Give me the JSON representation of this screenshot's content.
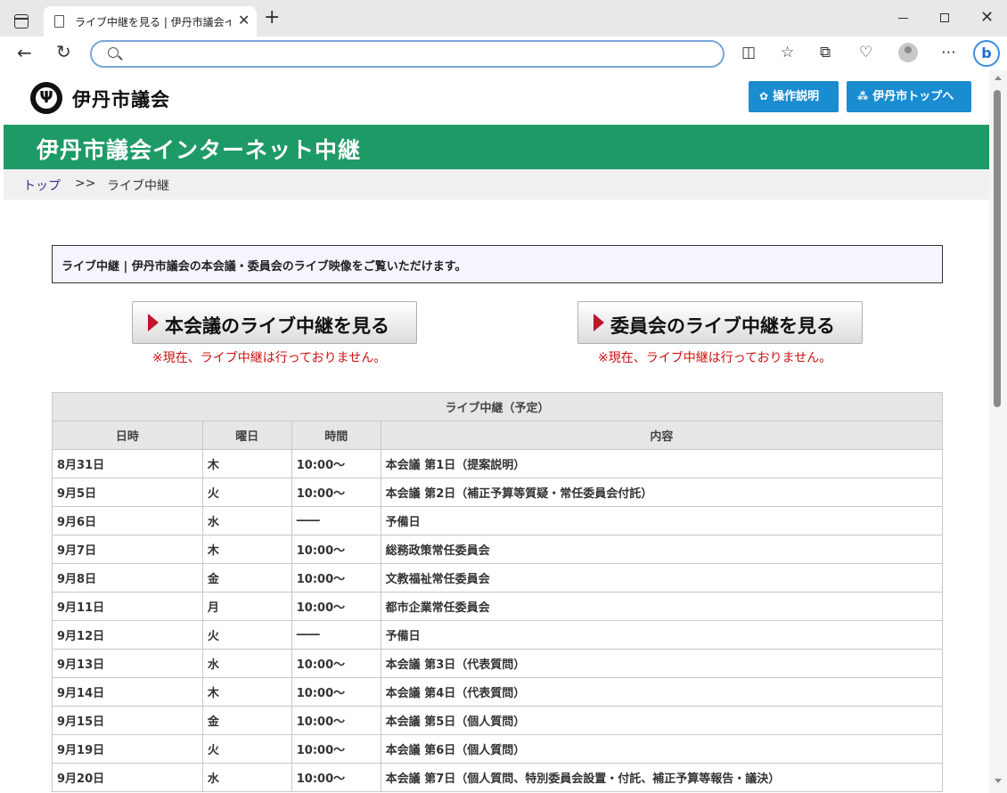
{
  "browser": {
    "tab_title": "ライブ中継を見る | 伊丹市議会インタ",
    "address": ""
  },
  "header": {
    "site_name": "伊丹市議会",
    "help_button": "操作説明",
    "home_button": "伊丹市トップへ",
    "help_icon": "gear-icon",
    "home_icon": "sitemap-icon"
  },
  "banner": {
    "title": "伊丹市議会インターネット中継"
  },
  "breadcrumb": {
    "top": "トップ",
    "separator": ">>",
    "current": "ライブ中継"
  },
  "intro": "ライブ中継 | 伊丹市議会の本会議・委員会のライブ映像をご覧いただけます。",
  "live": {
    "plenary_button": "本会議のライブ中継を見る",
    "committee_button": "委員会のライブ中継を見る",
    "plenary_notice": "※現在、ライブ中継は行っておりません。",
    "committee_notice": "※現在、ライブ中継は行っておりません。"
  },
  "schedule": {
    "caption": "ライブ中継（予定）",
    "headers": [
      "日時",
      "曜日",
      "時間",
      "内容"
    ],
    "rows": [
      [
        "8月31日",
        "木",
        "10:00～",
        "本会議 第1日（提案説明）"
      ],
      [
        "9月5日",
        "火",
        "10:00～",
        "本会議 第2日（補正予算等質疑・常任委員会付託）"
      ],
      [
        "9月6日",
        "水",
        "――",
        "予備日"
      ],
      [
        "9月7日",
        "木",
        "10:00～",
        "総務政策常任委員会"
      ],
      [
        "9月8日",
        "金",
        "10:00～",
        "文教福祉常任委員会"
      ],
      [
        "9月11日",
        "月",
        "10:00～",
        "都市企業常任委員会"
      ],
      [
        "9月12日",
        "火",
        "――",
        "予備日"
      ],
      [
        "9月13日",
        "水",
        "10:00～",
        "本会議 第3日（代表質問）"
      ],
      [
        "9月14日",
        "木",
        "10:00～",
        "本会議 第4日（代表質問）"
      ],
      [
        "9月15日",
        "金",
        "10:00～",
        "本会議 第5日（個人質問）"
      ],
      [
        "9月19日",
        "火",
        "10:00～",
        "本会議 第6日（個人質問）"
      ],
      [
        "9月20日",
        "水",
        "10:00～",
        "本会議 第7日（個人質問、特別委員会設置・付託、補正予算等報告・議決）"
      ]
    ]
  },
  "colors": {
    "banner": "#1e9a66",
    "header_button": "#1a8cd0",
    "notice": "#cc1111",
    "play_triangle": "#c0152a"
  }
}
